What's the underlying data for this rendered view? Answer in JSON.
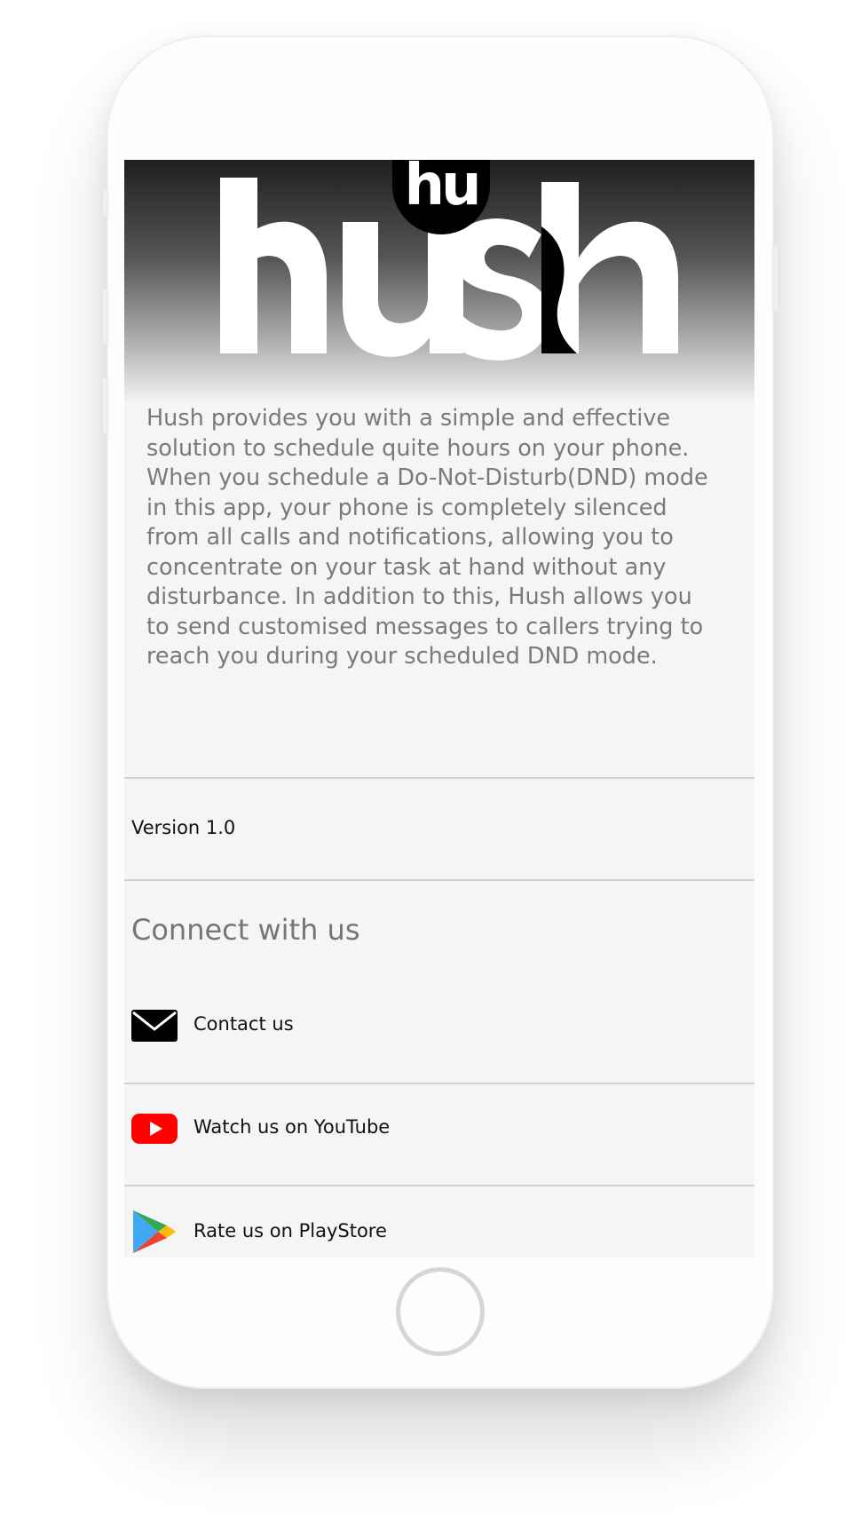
{
  "app": {
    "name": "hush",
    "badge_text": "hu"
  },
  "about": {
    "description": "Hush provides you with a simple and effective solution to schedule quite hours on your phone. When you schedule a Do-Not-Disturb(DND) mode in this app, your phone is completely silenced from all calls and notifications, allowing you to concentrate on your task at hand without any disturbance. In addition to this, Hush allows you to send customised messages to callers trying to reach you during your scheduled DND mode.",
    "version": "Version 1.0"
  },
  "connect": {
    "title": "Connect with us",
    "links": [
      {
        "label": "Contact us",
        "icon": "mail-icon"
      },
      {
        "label": "Watch us on YouTube",
        "icon": "youtube-icon"
      },
      {
        "label": "Rate us on PlayStore",
        "icon": "playstore-icon"
      }
    ]
  },
  "colors": {
    "youtube_red": "#ff0000",
    "text_gray": "#7a7a7a",
    "screen_bg": "#f5f5f5"
  }
}
